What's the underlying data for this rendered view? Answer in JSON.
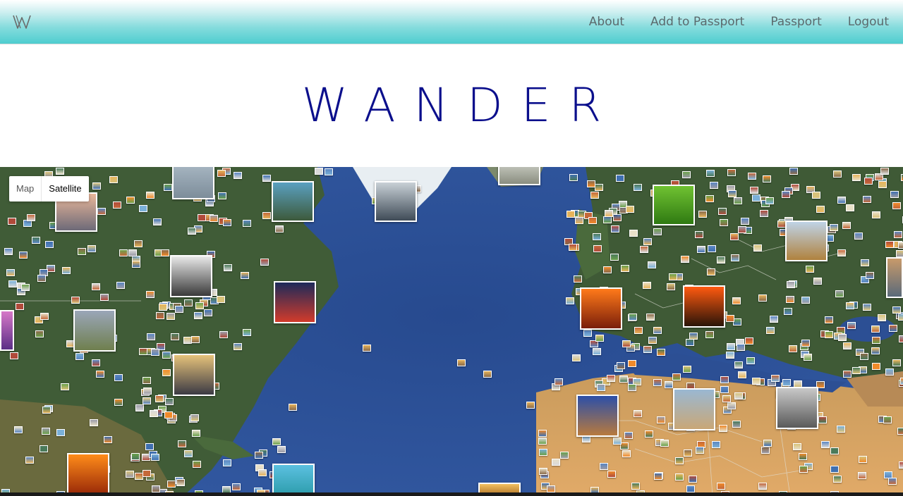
{
  "brand": {
    "logo_text": "W",
    "icon": "wander-w-logo-icon"
  },
  "nav": {
    "links": [
      "About",
      "Add to Passport",
      "Passport",
      "Logout"
    ]
  },
  "title": "WANDER",
  "map": {
    "type_options": [
      "Map",
      "Satellite"
    ],
    "selected_type": "Satellite",
    "colors": {
      "ocean": "#2d4f98",
      "land_green": "#3f5a36",
      "desert": "#d8a05a"
    },
    "featured_photos": [
      {
        "name": "snowy-landscape-photo",
        "colors": [
          "#a9b8c4",
          "#7d8d9a"
        ]
      },
      {
        "name": "sunset-lake-photo",
        "colors": [
          "#e9b79a",
          "#6d6a78"
        ]
      },
      {
        "name": "coastal-rocks-photo",
        "colors": [
          "#5aa0c0",
          "#3d5a3b"
        ]
      },
      {
        "name": "fjord-photo",
        "colors": [
          "#c8d0d6",
          "#3f4b57"
        ]
      },
      {
        "name": "rocky-shore-photo",
        "colors": [
          "#c9cbc2",
          "#8a8e80"
        ]
      },
      {
        "name": "green-field-photo",
        "colors": [
          "#70c232",
          "#2f7a12"
        ]
      },
      {
        "name": "cathedral-photo",
        "colors": [
          "#bfd3e6",
          "#b0823e"
        ]
      },
      {
        "name": "black-white-lake-photo",
        "colors": [
          "#e8e8e8",
          "#3a3a3a"
        ]
      },
      {
        "name": "city-night-photo",
        "colors": [
          "#1d2a5a",
          "#d23b2b"
        ]
      },
      {
        "name": "prairie-sky-photo",
        "colors": [
          "#9aa6b8",
          "#6f7f4e"
        ]
      },
      {
        "name": "purple-sunset-photo",
        "colors": [
          "#d678c8",
          "#5b2f86"
        ]
      },
      {
        "name": "winter-river-photo",
        "colors": [
          "#e6c27a",
          "#3b3a44"
        ]
      },
      {
        "name": "orange-sunset-photo",
        "colors": [
          "#ff7a1a",
          "#7a1e0a"
        ]
      },
      {
        "name": "red-sun-photo",
        "colors": [
          "#ff5a10",
          "#2a1408"
        ]
      },
      {
        "name": "desert-night-photo",
        "colors": [
          "#2c4fa8",
          "#b87a3e"
        ]
      },
      {
        "name": "sand-dunes-photo",
        "colors": [
          "#9ab8d2",
          "#c9a777"
        ]
      },
      {
        "name": "tent-photo",
        "colors": [
          "#c8c8c8",
          "#5a5a5a"
        ]
      },
      {
        "name": "canyon-photo",
        "colors": [
          "#ff8c1a",
          "#9a2a08"
        ]
      },
      {
        "name": "tropical-beach-photo",
        "colors": [
          "#5bc0e0",
          "#2a9aa8"
        ]
      },
      {
        "name": "golden-sky-photo",
        "colors": [
          "#f2c060",
          "#a86a20"
        ]
      },
      {
        "name": "coastline-photo",
        "colors": [
          "#c89a6a",
          "#5a6a7a"
        ]
      }
    ],
    "thumbnail_palette": [
      "#e6b35a",
      "#5a86c2",
      "#c4683a",
      "#6aa04a",
      "#d9d9d9",
      "#8a6a4a",
      "#3f6fb0",
      "#f08a2a",
      "#7ab0d8",
      "#b04a3a",
      "#d8c27a",
      "#4a7a5a",
      "#9a9aa6",
      "#e8e0c8"
    ]
  }
}
